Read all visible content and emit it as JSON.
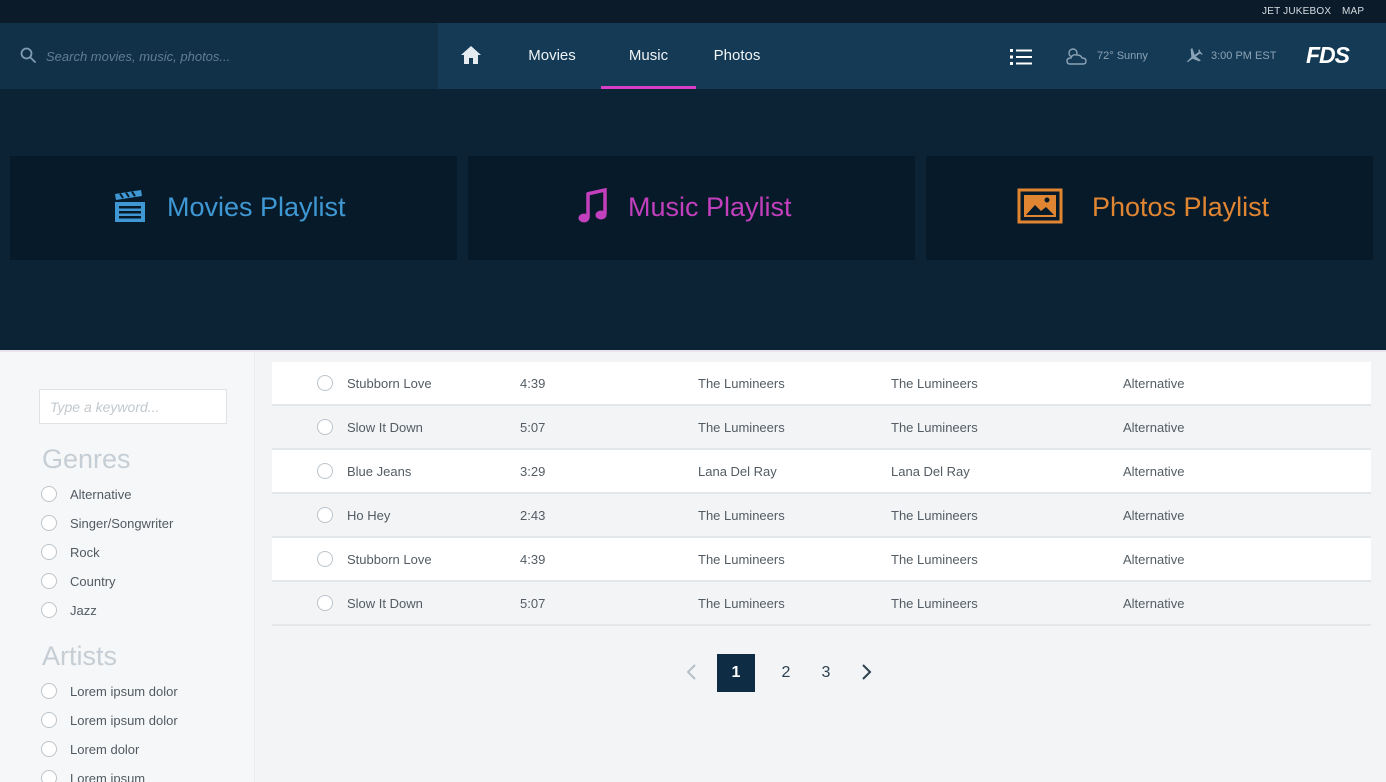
{
  "utility": {
    "jukebox": "JET JUKEBOX",
    "map": "MAP"
  },
  "search": {
    "placeholder": "Search movies, music, photos..."
  },
  "nav": {
    "tabs": [
      {
        "label": "Movies"
      },
      {
        "label": "Music",
        "active": true
      },
      {
        "label": "Photos"
      }
    ],
    "weather": "72° Sunny",
    "time": "3:00 PM EST",
    "logo": "FDS"
  },
  "playlists": [
    {
      "label": "Movies Playlist",
      "color": "#3f98d3",
      "icon": "clapperboard-icon"
    },
    {
      "label": "Music Playlist",
      "color": "#c23fbd",
      "icon": "music-note-icon"
    },
    {
      "label": "Photos Playlist",
      "color": "#e08532",
      "icon": "image-icon"
    }
  ],
  "filters": {
    "keyword_placeholder": "Type a keyword...",
    "genres_heading": "Genres",
    "genres": [
      "Alternative",
      "Singer/Songwriter",
      "Rock",
      "Country",
      "Jazz"
    ],
    "artists_heading": "Artists",
    "artists": [
      "Lorem ipsum dolor",
      "Lorem ipsum dolor",
      "Lorem dolor",
      "Lorem ipsum"
    ]
  },
  "tracks": [
    {
      "title": "Stubborn Love",
      "duration": "4:39",
      "artist": "The Lumineers",
      "album": "The Lumineers",
      "genre": "Alternative"
    },
    {
      "title": "Slow It Down",
      "duration": "5:07",
      "artist": "The Lumineers",
      "album": "The Lumineers",
      "genre": "Alternative"
    },
    {
      "title": "Blue Jeans",
      "duration": "3:29",
      "artist": "Lana Del Ray",
      "album": "Lana Del Ray",
      "genre": "Alternative"
    },
    {
      "title": "Ho Hey",
      "duration": "2:43",
      "artist": "The Lumineers",
      "album": "The Lumineers",
      "genre": "Alternative"
    },
    {
      "title": "Stubborn Love",
      "duration": "4:39",
      "artist": "The Lumineers",
      "album": "The Lumineers",
      "genre": "Alternative"
    },
    {
      "title": "Slow It Down",
      "duration": "5:07",
      "artist": "The Lumineers",
      "album": "The Lumineers",
      "genre": "Alternative"
    }
  ],
  "pagination": {
    "pages": [
      "1",
      "2",
      "3"
    ],
    "current": "1"
  },
  "colors": {
    "accent": "#d63fc6",
    "nav": "#153a55",
    "hero": "#0c2336",
    "tile": "#071a29"
  }
}
